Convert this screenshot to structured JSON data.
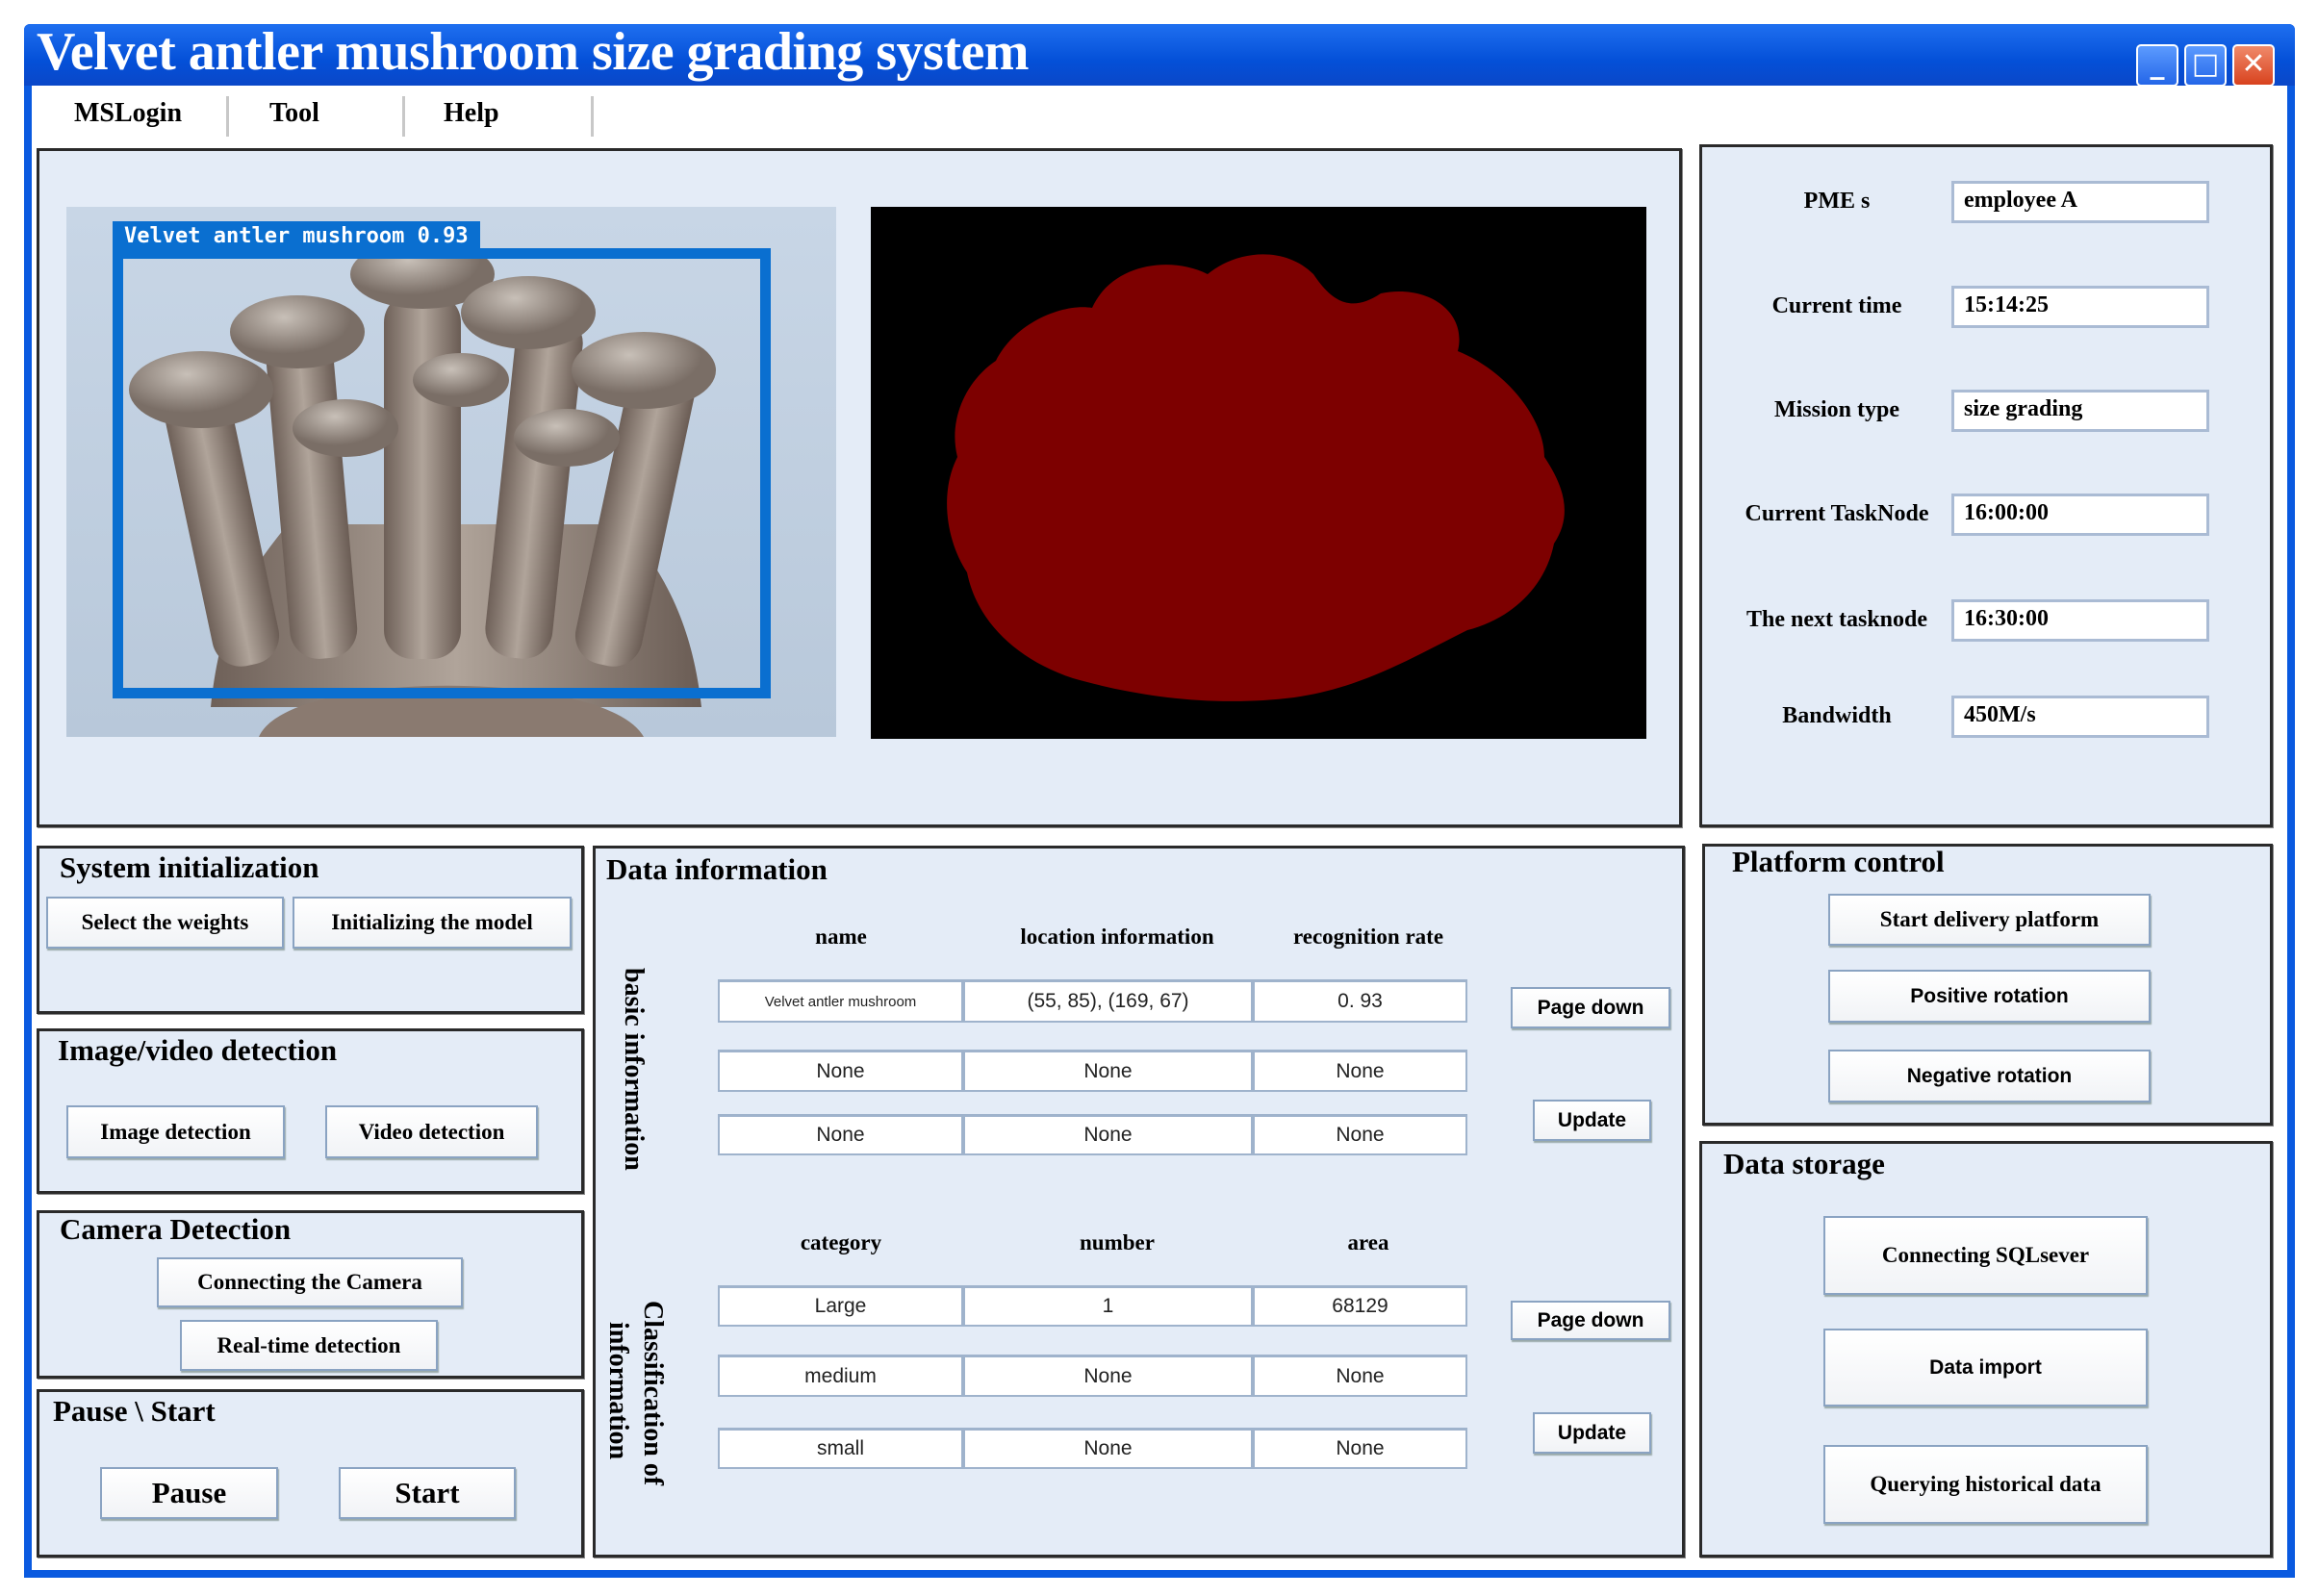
{
  "window": {
    "title": "Velvet antler mushroom size grading system",
    "minimize": "_",
    "maximize": "□",
    "close": "✕"
  },
  "menu": [
    "MSLogin",
    "Tool",
    "Help"
  ],
  "detection": {
    "label": "Velvet antler mushroom 0.93",
    "box_color": "#0a6fd0",
    "mask_color": "#7d0000"
  },
  "status": [
    {
      "label": "PME s",
      "value": "employee A"
    },
    {
      "label": "Current time",
      "value": "15:14:25"
    },
    {
      "label": "Mission type",
      "value": "size grading"
    },
    {
      "label": "Current TaskNode",
      "value": "16:00:00"
    },
    {
      "label": "The next tasknode",
      "value": "16:30:00"
    },
    {
      "label": "Bandwidth",
      "value": "450M/s"
    }
  ],
  "system_init": {
    "title": "System initialization",
    "buttons": [
      "Select the weights",
      "Initializing the model"
    ]
  },
  "image_video": {
    "title": "Image/video detection",
    "buttons": [
      "Image detection",
      "Video detection"
    ]
  },
  "camera": {
    "title": "Camera Detection",
    "buttons": [
      "Connecting the Camera",
      "Real-time detection"
    ]
  },
  "pause_start": {
    "title": "Pause \\ Start",
    "buttons": [
      "Pause",
      "Start"
    ]
  },
  "data_info": {
    "title": "Data information",
    "basic": {
      "side_label": "basic information",
      "headers": [
        "name",
        "location information",
        "recognition rate"
      ],
      "rows": [
        [
          "Velvet antler mushroom",
          "(55, 85), (169, 67)",
          "0. 93"
        ],
        [
          "None",
          "None",
          "None"
        ],
        [
          "None",
          "None",
          "None"
        ]
      ],
      "page_down": "Page down",
      "update": "Update"
    },
    "classification": {
      "side_label_1": "Classification of",
      "side_label_2": "information",
      "headers": [
        "category",
        "number",
        "area"
      ],
      "rows": [
        [
          "Large",
          "1",
          "68129"
        ],
        [
          "medium",
          "None",
          "None"
        ],
        [
          "small",
          "None",
          "None"
        ]
      ],
      "page_down": "Page down",
      "update": "Update"
    }
  },
  "platform": {
    "title": "Platform control",
    "buttons": [
      "Start delivery platform",
      "Positive rotation",
      "Negative rotation"
    ]
  },
  "storage": {
    "title": "Data storage",
    "buttons": [
      "Connecting SQLsever",
      "Data import",
      "Querying historical data"
    ]
  }
}
